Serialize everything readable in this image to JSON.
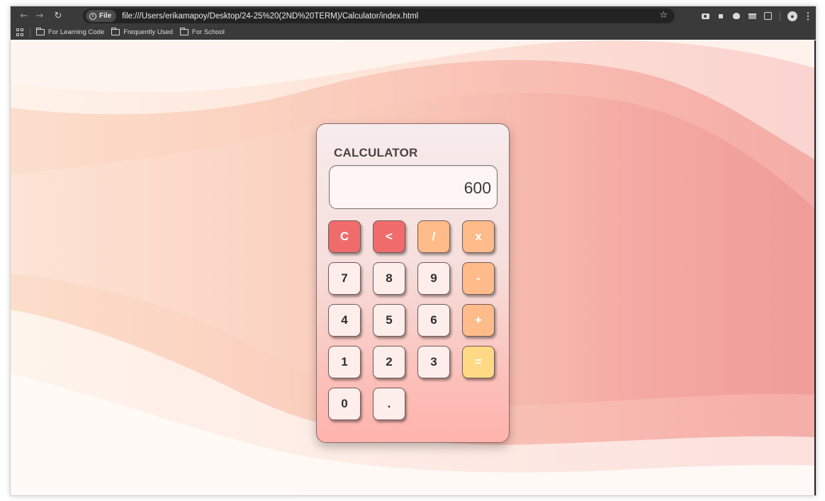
{
  "browser": {
    "file_chip": "File",
    "url": "file:///Users/erikamapoy/Desktop/24-25%20(2ND%20TERM)/Calculator/index.html",
    "bookmarks": [
      "For Learning Code",
      "Frequently Used",
      "For School"
    ]
  },
  "calculator": {
    "title": "CALCULATOR",
    "display_value": "600",
    "keys": {
      "clear": "C",
      "backspace": "<",
      "divide": "/",
      "multiply": "x",
      "seven": "7",
      "eight": "8",
      "nine": "9",
      "subtract": "-",
      "four": "4",
      "five": "5",
      "six": "6",
      "add": "+",
      "one": "1",
      "two": "2",
      "three": "3",
      "equals": "=",
      "zero": "0",
      "decimal": "."
    }
  },
  "colors": {
    "red_key": "#f06c6c",
    "orange_key": "#ffbb8a",
    "yellow_key": "#ffd983",
    "number_key": "#fdeeec"
  }
}
